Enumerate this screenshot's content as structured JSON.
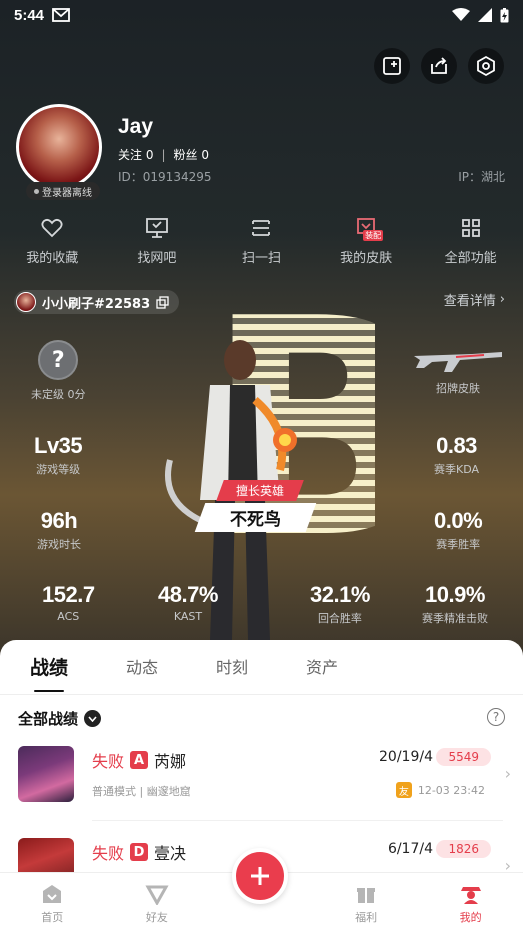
{
  "status_bar": {
    "time": "5:44"
  },
  "profile": {
    "avatar_badge": "登录器离线",
    "username": "Jay",
    "follow_label": "关注",
    "follow_count": "0",
    "fans_label": "粉丝",
    "fans_count": "0",
    "separator": "|",
    "uid": "ID：019134295",
    "ip": "IP：湖北"
  },
  "quick_actions": [
    {
      "label": "我的收藏",
      "icon": "heart-icon"
    },
    {
      "label": "找网吧",
      "icon": "monitor-icon"
    },
    {
      "label": "扫一扫",
      "icon": "scan-icon"
    },
    {
      "label": "我的皮肤",
      "icon": "skin-icon",
      "tag": "装配"
    },
    {
      "label": "全部功能",
      "icon": "grid-icon"
    }
  ],
  "game_card": {
    "name": "小小刷子#22583",
    "details_link": "查看详情"
  },
  "stats": {
    "rank": {
      "symbol": "?",
      "label": "未定级 0分"
    },
    "signature_skin": {
      "label": "招牌皮肤"
    },
    "level": {
      "value": "Lv35",
      "label": "游戏等级"
    },
    "kda": {
      "value": "0.83",
      "label": "赛季KDA"
    },
    "playtime": {
      "value": "96h",
      "label": "游戏时长"
    },
    "winrate": {
      "value": "0.0%",
      "label": "赛季胜率"
    },
    "acs": {
      "value": "152.7",
      "label": "ACS"
    },
    "kast": {
      "value": "48.7%",
      "label": "KAST"
    },
    "round_win": {
      "value": "32.1%",
      "label": "回合胜率"
    },
    "precision": {
      "value": "10.9%",
      "label": "赛季精准击败"
    }
  },
  "hero_tag": {
    "title": "擅长英雄",
    "name": "不死鸟"
  },
  "tabs": [
    "战绩",
    "动态",
    "时刻",
    "资产"
  ],
  "filter": {
    "label": "全部战绩"
  },
  "matches": [
    {
      "result": "失败",
      "grade": "A",
      "agent": "芮娜",
      "kda": "20/19/4",
      "score": "5549",
      "mode": "普通模式 | 幽邃地窟",
      "friend_tag": "友",
      "time": "12-03 23:42"
    },
    {
      "result": "失败",
      "grade": "D",
      "agent": "壹决",
      "kda": "6/17/4",
      "score": "1826"
    }
  ],
  "nav": [
    {
      "label": "首页",
      "icon": "home-icon"
    },
    {
      "label": "好友",
      "icon": "friends-icon"
    },
    {
      "label": "福利",
      "icon": "gift-icon"
    },
    {
      "label": "我的",
      "icon": "profile-icon"
    }
  ],
  "colors": {
    "accent": "#e43d4b",
    "badge_gold": "#f0a21c"
  }
}
